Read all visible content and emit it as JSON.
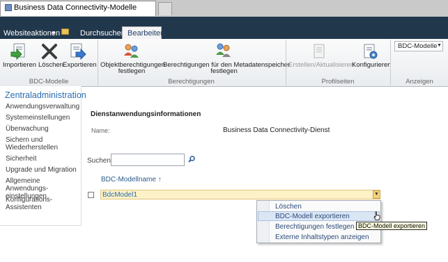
{
  "browser": {
    "tab_title": "Business Data Connectivity-Modelle"
  },
  "ribbon_tabs": {
    "site_actions": "Websiteaktionen",
    "browse": "Durchsuchen",
    "edit": "Bearbeiten"
  },
  "ribbon": {
    "groups": {
      "bdc_models": "BDC-Modelle",
      "permissions": "Berechtigungen",
      "profile_pages": "Profilseiten",
      "view": "Anzeigen"
    },
    "buttons": {
      "import": "Importieren",
      "delete": "Löschen",
      "export": "Exportieren",
      "object_permissions_line1": "Objektberechtigungen",
      "object_permissions_line2": "festlegen",
      "metadata_permissions_line1": "Berechtigungen für den Metadatenspeicher",
      "metadata_permissions_line2": "festlegen",
      "create_update": "Erstellen/Aktualisieren",
      "configure": "Konfigurieren"
    },
    "view_dropdown": "BDC-Modelle"
  },
  "leftnav": {
    "title": "Zentraladministration",
    "items": [
      "Anwendungsverwaltung",
      "Systemeinstellungen",
      "Überwachung",
      "Sichern und Wiederherstellen",
      "Sicherheit",
      "Upgrade und Migration",
      "Allgemeine Anwendungs-einstellungen",
      "Konfigurations-Assistenten"
    ]
  },
  "main": {
    "section_heading": "Dienstanwendungsinformationen",
    "name_label": "Name:",
    "name_value": "Business Data Connectivity-Dienst",
    "search_label": "Suchen",
    "search_value": "",
    "column_header": "BDC-Modellname",
    "sort_indicator": "↑",
    "rows": [
      {
        "name": "BdcModel1"
      }
    ]
  },
  "context_menu": {
    "items": [
      "Löschen",
      "BDC-Modell exportieren",
      "Berechtigungen festlegen",
      "Externe Inhaltstypen anzeigen"
    ],
    "highlighted_index": 1
  },
  "tooltip": "BDC-Modell exportieren"
}
